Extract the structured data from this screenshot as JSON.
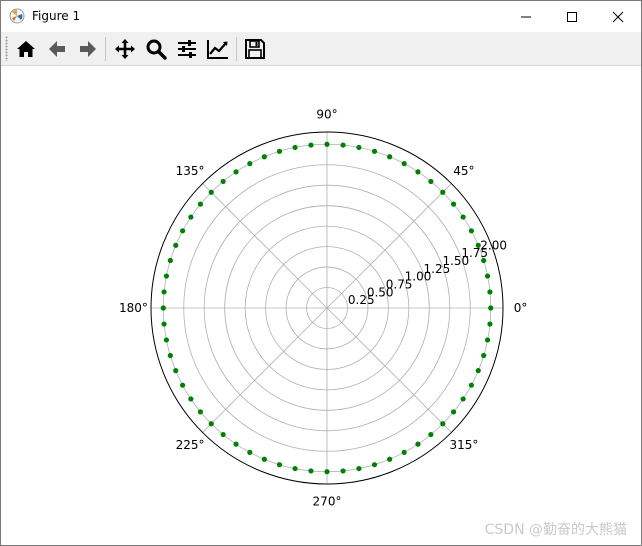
{
  "window": {
    "title": "Figure 1",
    "controls": {
      "minimize": "minimize",
      "maximize": "maximize",
      "close": "close"
    }
  },
  "toolbar": {
    "items": [
      {
        "name": "home",
        "icon": "home-icon",
        "tooltip": "Reset original view"
      },
      {
        "name": "back",
        "icon": "arrow-left-icon",
        "tooltip": "Back to previous view"
      },
      {
        "name": "forward",
        "icon": "arrow-right-icon",
        "tooltip": "Forward to next view"
      },
      {
        "name": "pan",
        "icon": "move-icon",
        "tooltip": "Pan axes"
      },
      {
        "name": "zoom",
        "icon": "magnifier-icon",
        "tooltip": "Zoom to rectangle"
      },
      {
        "name": "subplots",
        "icon": "sliders-icon",
        "tooltip": "Configure subplots"
      },
      {
        "name": "axes",
        "icon": "line-chart-icon",
        "tooltip": "Edit axis"
      },
      {
        "name": "save",
        "icon": "floppy-disk-icon",
        "tooltip": "Save the figure"
      }
    ]
  },
  "chart_data": {
    "type": "scatter",
    "projection": "polar",
    "angle_ticks": [
      "0°",
      "45°",
      "90°",
      "135°",
      "180°",
      "225°",
      "270°",
      "315°"
    ],
    "angle_tick_values_deg": [
      0,
      45,
      90,
      135,
      180,
      225,
      270,
      315
    ],
    "radial_ticks": [
      "0.25",
      "0.50",
      "0.75",
      "1.00",
      "1.25",
      "1.50",
      "1.75",
      "2.00"
    ],
    "radial_tick_values": [
      0.25,
      0.5,
      0.75,
      1.0,
      1.25,
      1.5,
      1.75,
      2.0
    ],
    "radial_label_angle_deg": 22.5,
    "rlim": [
      0,
      2.15
    ],
    "grid": true,
    "series": [
      {
        "marker": "circle",
        "color": "#008000",
        "r": 2.0,
        "theta_start_deg": 0,
        "theta_step_deg": 5.625,
        "count": 64
      }
    ]
  },
  "watermark": "CSDN @勤奋的大熊猫"
}
